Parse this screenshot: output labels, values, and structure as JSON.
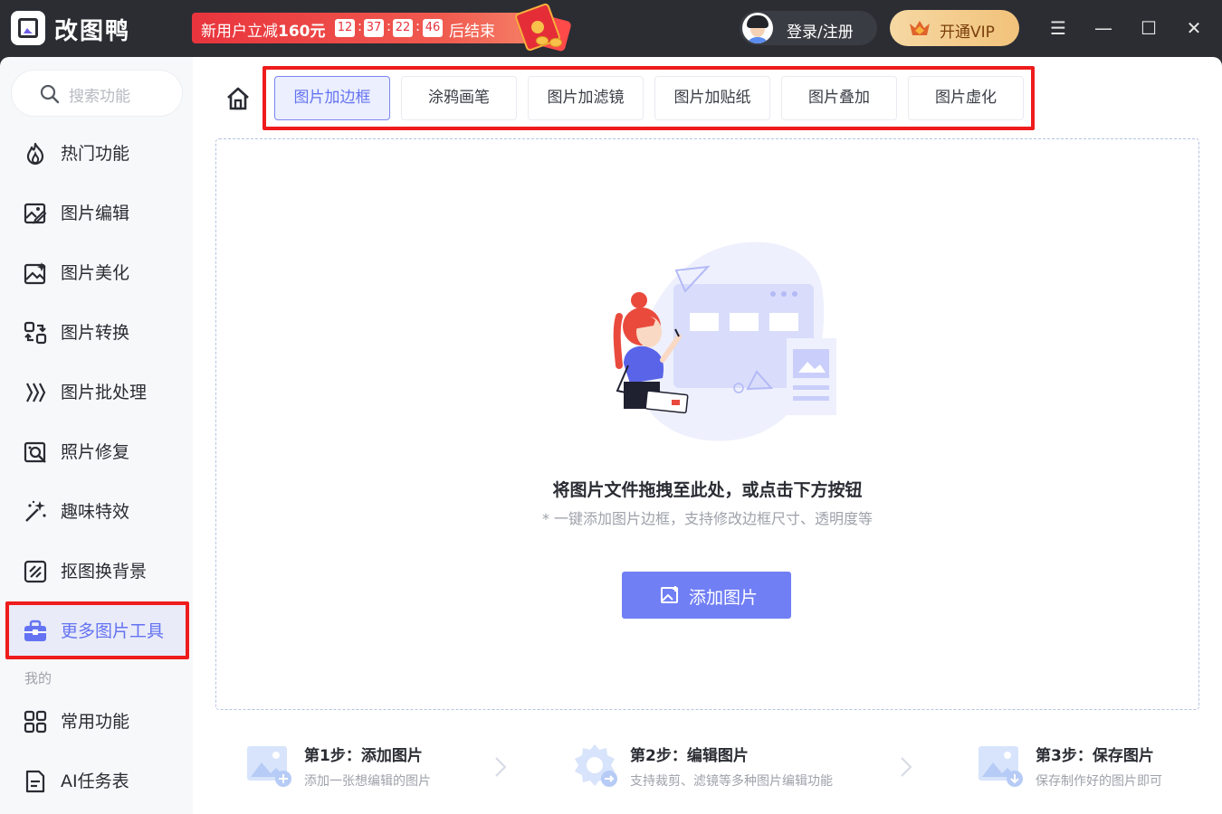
{
  "app": {
    "name": "改图鸭"
  },
  "promo": {
    "text_prefix": "新用户立减",
    "amount": "160元",
    "countdown": [
      "12",
      "37",
      "22",
      "46"
    ],
    "text_suffix": "后结束"
  },
  "account": {
    "login_label": "登录/注册",
    "vip_label": "开通VIP"
  },
  "window_controls": {
    "menu": "☰",
    "minimize": "—",
    "maximize": "☐",
    "close": "✕"
  },
  "sidebar": {
    "search_placeholder": "搜索功能",
    "items": [
      {
        "label": "热门功能",
        "icon": "flame-icon"
      },
      {
        "label": "图片编辑",
        "icon": "image-edit-icon"
      },
      {
        "label": "图片美化",
        "icon": "image-sparkle-icon"
      },
      {
        "label": "图片转换",
        "icon": "convert-icon"
      },
      {
        "label": "图片批处理",
        "icon": "batch-icon"
      },
      {
        "label": "照片修复",
        "icon": "photo-repair-icon"
      },
      {
        "label": "趣味特效",
        "icon": "magic-wand-icon"
      },
      {
        "label": "抠图换背景",
        "icon": "cutout-icon"
      },
      {
        "label": "更多图片工具",
        "icon": "toolbox-icon",
        "active": true
      }
    ],
    "section_mine": "我的",
    "mine_items": [
      {
        "label": "常用功能",
        "icon": "grid-icon"
      },
      {
        "label": "AI任务表",
        "icon": "document-icon"
      }
    ]
  },
  "tabs": [
    {
      "label": "图片加边框",
      "active": true
    },
    {
      "label": "涂鸦画笔"
    },
    {
      "label": "图片加滤镜"
    },
    {
      "label": "图片加贴纸"
    },
    {
      "label": "图片叠加"
    },
    {
      "label": "图片虚化"
    }
  ],
  "dropzone": {
    "title": "将图片文件拖拽至此处，或点击下方按钮",
    "subtitle": "* 一键添加图片边框，支持修改边框尺寸、透明度等",
    "button_label": "添加图片"
  },
  "steps": [
    {
      "title": "第1步：添加图片",
      "desc": "添加一张想编辑的图片"
    },
    {
      "title": "第2步：编辑图片",
      "desc": "支持裁剪、滤镜等多种图片编辑功能"
    },
    {
      "title": "第3步：保存图片",
      "desc": "保存制作好的图片即可"
    }
  ],
  "colors": {
    "accent": "#717ff5",
    "highlight_outline": "#ee1c1c",
    "titlebar": "#2b2d33"
  }
}
